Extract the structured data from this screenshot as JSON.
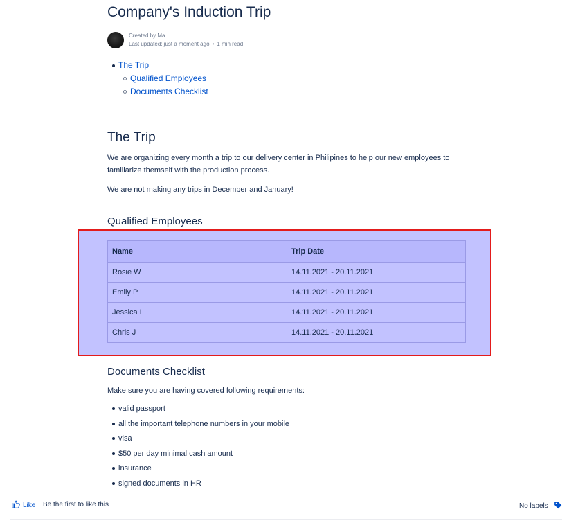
{
  "page": {
    "title": "Company's Induction Trip"
  },
  "byline": {
    "created": "Created by Ma",
    "updated": "Last updated: just a moment ago",
    "read_time": "1 min read"
  },
  "toc": {
    "items": [
      {
        "label": "The Trip",
        "level": 1
      },
      {
        "label": "Qualified Employees",
        "level": 2
      },
      {
        "label": "Documents Checklist",
        "level": 2
      }
    ]
  },
  "trip_section": {
    "heading": "The Trip",
    "paragraph1": "We are organizing every month a trip to our delivery center in Philipines to help our new employees to familiarize themself with the production process.",
    "paragraph2": "We are not making any trips in December and January!"
  },
  "employees_section": {
    "heading": "Qualified Employees",
    "table": {
      "headers": [
        "Name",
        "Trip Date"
      ],
      "rows": [
        [
          "Rosie W",
          "14.11.2021 - 20.11.2021"
        ],
        [
          "Emily P",
          "14.11.2021 - 20.11.2021"
        ],
        [
          "Jessica L",
          "14.11.2021 - 20.11.2021"
        ],
        [
          "Chris J",
          "14.11.2021 - 20.11.2021"
        ]
      ]
    }
  },
  "documents_section": {
    "heading": "Documents Checklist",
    "intro": "Make sure you are having covered following requirements:",
    "items": [
      "valid passport",
      "all the important telephone numbers in your mobile",
      "visa",
      "$50 per day minimal cash amount",
      "insurance",
      "signed documents in HR"
    ]
  },
  "footer": {
    "like_label": "Like",
    "like_hint": "Be the first to like this",
    "labels_text": "No labels"
  },
  "colors": {
    "link": "#0052cc",
    "text": "#172b4d",
    "highlight_border": "#e31b1b",
    "highlight_fill": "#7878ff"
  },
  "icons": {
    "like": "thumbs-up-icon",
    "labels": "tag-icon"
  }
}
